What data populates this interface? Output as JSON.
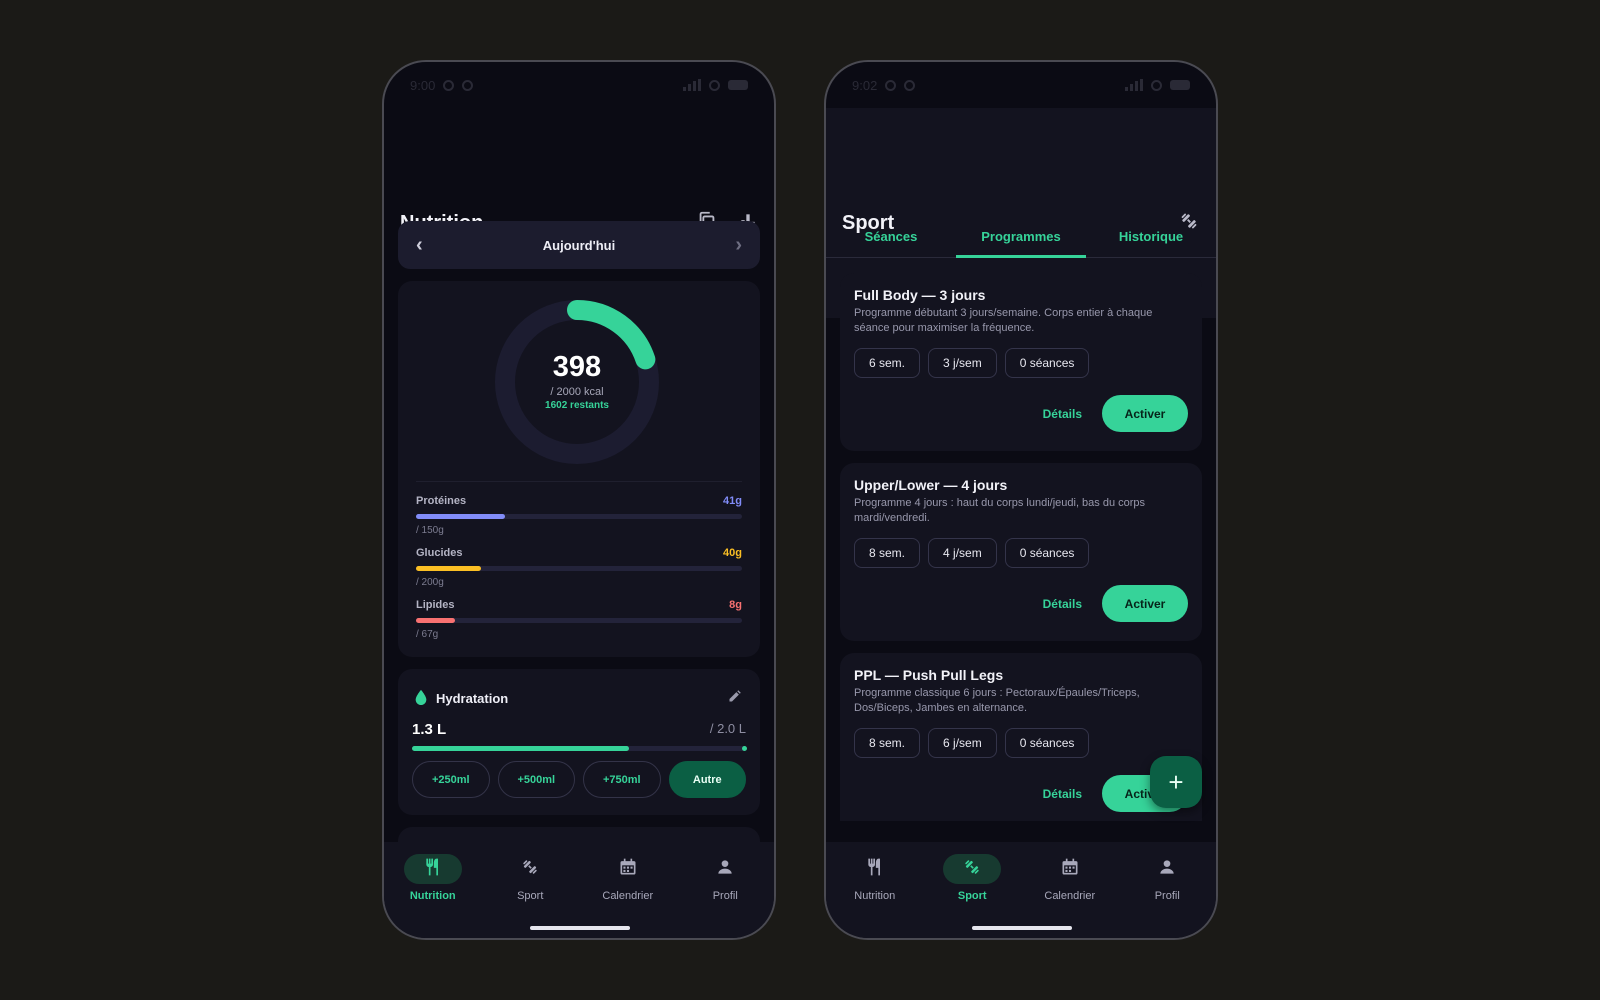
{
  "nutrition": {
    "status": {
      "time": "9:00"
    },
    "title": "Nutrition",
    "header_icons": [
      "copy-icon",
      "bar-chart-icon"
    ],
    "date_nav": {
      "label": "Aujourd'hui",
      "prev_icon": "chevron-left-icon",
      "next_icon": "chevron-right-icon"
    },
    "calories": {
      "consumed": "398",
      "goal_label": "/ 2000 kcal",
      "remaining_label": "1602 restants",
      "progress": 0.199
    },
    "macros": [
      {
        "name": "Protéines",
        "value": "41g",
        "goal": "/ 150g",
        "progress": 0.273,
        "color": "#818cf8"
      },
      {
        "name": "Glucides",
        "value": "40g",
        "goal": "/ 200g",
        "progress": 0.2,
        "color": "#fbbf24"
      },
      {
        "name": "Lipides",
        "value": "8g",
        "goal": "/ 67g",
        "progress": 0.119,
        "color": "#f87171"
      }
    ],
    "hydration": {
      "title": "Hydratation",
      "icon": "water-drop-icon",
      "edit_icon": "pencil-icon",
      "current": "1.3 L",
      "goal": "/ 2.0 L",
      "progress": 0.65,
      "buttons": [
        "+250ml",
        "+500ml",
        "+750ml",
        "Autre"
      ]
    },
    "nav": [
      {
        "label": "Nutrition",
        "icon": "fork-knife-icon",
        "active": true
      },
      {
        "label": "Sport",
        "icon": "dumbbell-icon",
        "active": false
      },
      {
        "label": "Calendrier",
        "icon": "calendar-icon",
        "active": false
      },
      {
        "label": "Profil",
        "icon": "person-icon",
        "active": false
      }
    ]
  },
  "sport": {
    "status": {
      "time": "9:02"
    },
    "title": "Sport",
    "header_icon": "dumbbell-icon",
    "tabs": [
      {
        "label": "Séances",
        "active": false
      },
      {
        "label": "Programmes",
        "active": true
      },
      {
        "label": "Historique",
        "active": false
      }
    ],
    "programs": [
      {
        "title": "Full Body — 3 jours",
        "description": "Programme débutant 3 jours/semaine. Corps entier à chaque séance pour maximiser la fréquence.",
        "chips": [
          "6 sem.",
          "3 j/sem",
          "0 séances"
        ],
        "details": "Détails",
        "activate": "Activer"
      },
      {
        "title": "Upper/Lower — 4 jours",
        "description": "Programme 4 jours : haut du corps lundi/jeudi, bas du corps mardi/vendredi.",
        "chips": [
          "8 sem.",
          "4 j/sem",
          "0 séances"
        ],
        "details": "Détails",
        "activate": "Activer"
      },
      {
        "title": "PPL — Push Pull Legs",
        "description": "Programme classique 6 jours : Pectoraux/Épaules/Triceps, Dos/Biceps, Jambes en alternance.",
        "chips": [
          "8 sem.",
          "6 j/sem",
          "0 séances"
        ],
        "details": "Détails",
        "activate": "Activer"
      }
    ],
    "fab_icon": "plus-icon",
    "fab_label": "+",
    "nav": [
      {
        "label": "Nutrition",
        "icon": "fork-knife-icon",
        "active": false
      },
      {
        "label": "Sport",
        "icon": "dumbbell-icon",
        "active": true
      },
      {
        "label": "Calendrier",
        "icon": "calendar-icon",
        "active": false
      },
      {
        "label": "Profil",
        "icon": "person-icon",
        "active": false
      }
    ]
  },
  "colors": {
    "accent": "#36d399",
    "accent_dark": "#0b5f44",
    "card": "#13131f",
    "background": "#1b1a17"
  }
}
